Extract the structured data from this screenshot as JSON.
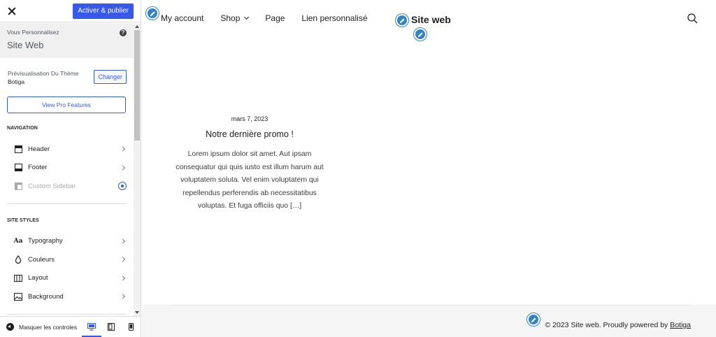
{
  "sidebar": {
    "close_icon": "close-icon",
    "publish_label": "Activer & publier",
    "info": {
      "you_customize": "Vous Personnalisez",
      "site_title": "Site Web",
      "help_icon": "?"
    },
    "theme": {
      "label": "Prévisualisation Du Thème",
      "name": "Botiga",
      "change_label": "Changer"
    },
    "pro_label": "View Pro Features",
    "navigation": {
      "heading": "NAVIGATION",
      "items": [
        {
          "label": "Header",
          "icon": "header-icon"
        },
        {
          "label": "Footer",
          "icon": "footer-icon"
        },
        {
          "label": "Custom Sidebar",
          "icon": "sidebar-icon",
          "disabled": true
        }
      ]
    },
    "site_styles": {
      "heading": "SITE STYLES",
      "items": [
        {
          "label": "Typography",
          "icon": "typography-icon",
          "glyph": "Aa"
        },
        {
          "label": "Couleurs",
          "icon": "color-drop-icon"
        },
        {
          "label": "Layout",
          "icon": "layout-icon"
        },
        {
          "label": "Background",
          "icon": "image-icon"
        }
      ]
    },
    "bottom": {
      "hide_label": "Masquer les controles",
      "devices": [
        "desktop",
        "tablet",
        "mobile"
      ],
      "active_device": "desktop"
    }
  },
  "preview": {
    "nav": [
      {
        "label": "My account"
      },
      {
        "label": "Shop"
      },
      {
        "label": "Page"
      },
      {
        "label": "Lien personnalisé"
      }
    ],
    "site_title": "Site web",
    "post": {
      "date": "mars 7, 2023",
      "title": "Notre dernière promo !",
      "excerpt": "Lorem ipsum dolor sit amet. Aut ipsam consequatur qui quis iusto est illum harum aut voluptatem soluta. Vel enim voluptatem qui repellendus perferendis ab necessitatibus voluptas. Et fuga officiis quo […]"
    },
    "footer": {
      "credit_prefix": "© 2023 Site web. Proudly powered by ",
      "credit_link": "Botiga"
    }
  },
  "colors": {
    "accent": "#3858e9",
    "edit_pencil": "#3582c4"
  }
}
